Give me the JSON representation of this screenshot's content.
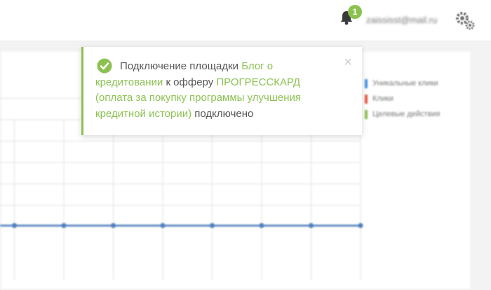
{
  "header": {
    "notifications_count": "1",
    "user_email": "zaississt@mail.ru"
  },
  "notification": {
    "part1": "Подключение площадки ",
    "site_name": "Блог о кредитовании",
    "part2": " к офферу ",
    "offer_name": "ПРОГРЕССКАРД (оплата за покупку программы улучшения кредитной истории)",
    "part3": " подключено",
    "close_symbol": "×"
  },
  "chart": {
    "legend": [
      {
        "label": "Уникальные клики",
        "color": "#4a90e2"
      },
      {
        "label": "Клики",
        "color": "#e9573f"
      },
      {
        "label": "Целевые действия",
        "color": "#8cc152"
      }
    ]
  },
  "chart_data": {
    "type": "line",
    "series": [
      {
        "name": "Уникальные клики",
        "values": [
          0,
          0,
          0,
          0,
          0,
          0,
          0,
          0
        ]
      }
    ]
  },
  "colors": {
    "accent": "#8cc152",
    "line": "#4f7fbf"
  }
}
